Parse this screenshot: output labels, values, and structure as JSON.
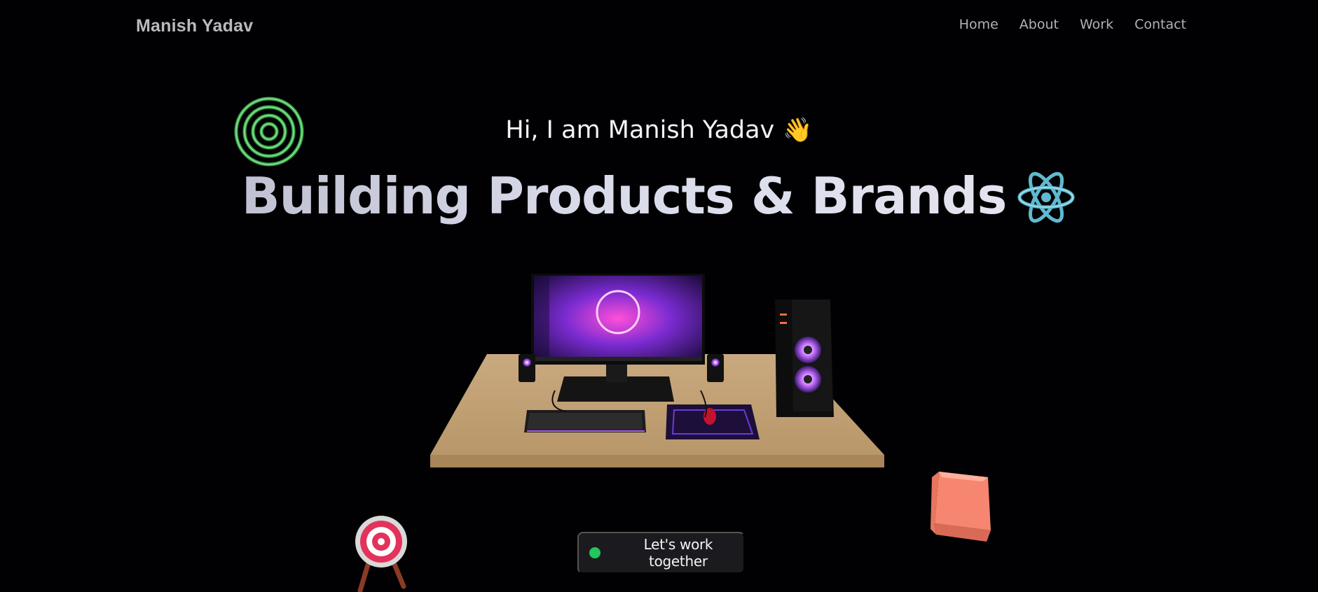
{
  "navbar": {
    "logo": "Manish Yadav",
    "links": [
      {
        "label": "Home"
      },
      {
        "label": "About"
      },
      {
        "label": "Work"
      },
      {
        "label": "Contact"
      }
    ]
  },
  "hero": {
    "greeting": "Hi, I am Manish Yadav",
    "greeting_emoji": "👋",
    "headline": "Building Products & Brands",
    "cta_label": "Let's work together",
    "cta_status_color": "#22c55e"
  },
  "icons": {
    "spiral": "spiral-rings-icon",
    "react": "react-atom-icon",
    "target": "target-icon",
    "cube": "cube-icon",
    "scene": "desk-setup-3d-model"
  },
  "colors": {
    "background": "#010103",
    "accent_green": "#22c55e",
    "react_blue": "#61c3d8",
    "cube_coral": "#f6866f"
  }
}
